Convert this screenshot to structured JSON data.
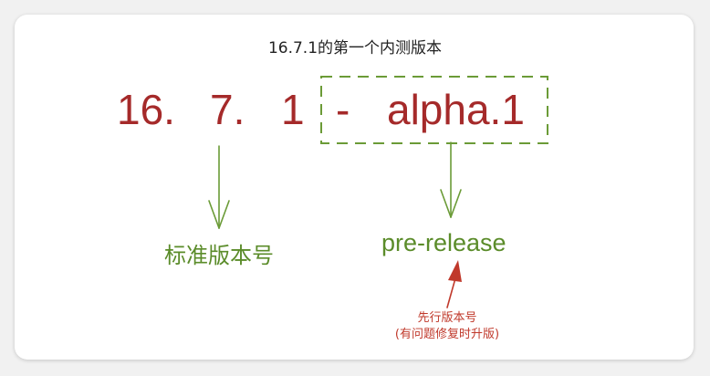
{
  "title": "16.7.1的第一个内测版本",
  "version": {
    "major": "16.",
    "minor": "7.",
    "patch": "1",
    "dash": "-",
    "prerelease": "alpha.1"
  },
  "labels": {
    "standard": "标准版本号",
    "prerelease": "pre-release"
  },
  "note": {
    "line1": "先行版本号",
    "line2": "(有问题修复时升版)"
  },
  "colors": {
    "version_text": "#a52a2a",
    "green": "#5b8c2a",
    "note_red": "#c0392b",
    "arrow_red": "#c0392b"
  }
}
